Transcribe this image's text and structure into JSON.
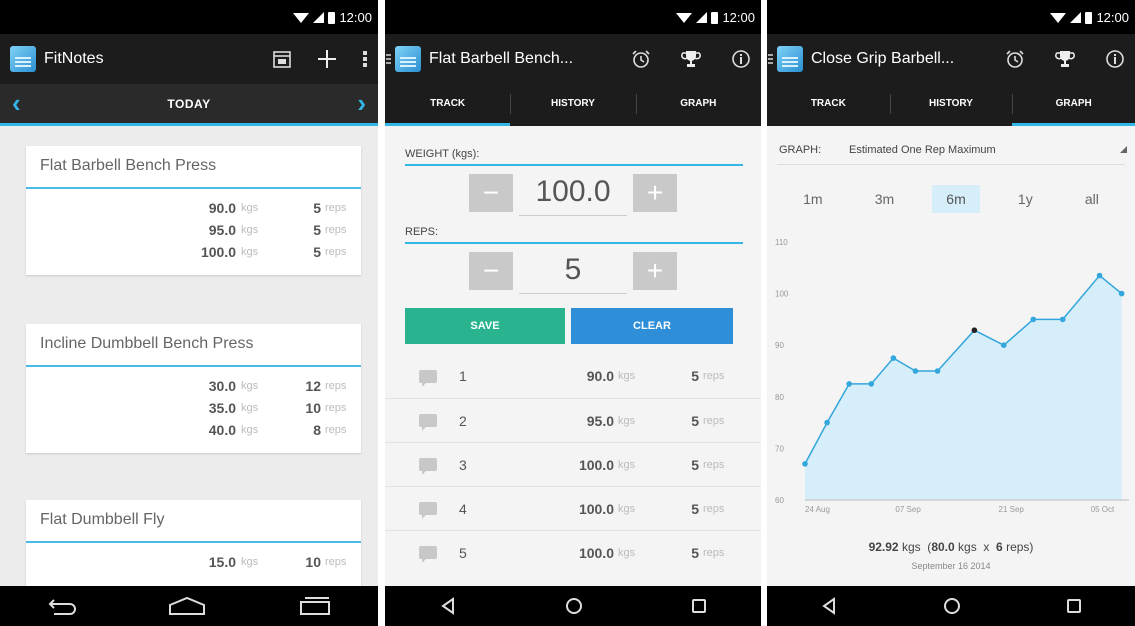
{
  "status": {
    "time": "12:00"
  },
  "screen1": {
    "app_title": "FitNotes",
    "date_label": "TODAY",
    "cards": [
      {
        "title": "Flat Barbell Bench Press",
        "sets": [
          {
            "weight": "90.0",
            "unit": "kgs",
            "reps": "5",
            "reps_unit": "reps"
          },
          {
            "weight": "95.0",
            "unit": "kgs",
            "reps": "5",
            "reps_unit": "reps"
          },
          {
            "weight": "100.0",
            "unit": "kgs",
            "reps": "5",
            "reps_unit": "reps"
          }
        ]
      },
      {
        "title": "Incline Dumbbell Bench Press",
        "sets": [
          {
            "weight": "30.0",
            "unit": "kgs",
            "reps": "12",
            "reps_unit": "reps"
          },
          {
            "weight": "35.0",
            "unit": "kgs",
            "reps": "10",
            "reps_unit": "reps"
          },
          {
            "weight": "40.0",
            "unit": "kgs",
            "reps": "8",
            "reps_unit": "reps"
          }
        ]
      },
      {
        "title": "Flat Dumbbell Fly",
        "sets": [
          {
            "weight": "15.0",
            "unit": "kgs",
            "reps": "10",
            "reps_unit": "reps"
          }
        ]
      }
    ]
  },
  "screen2": {
    "title": "Flat Barbell Bench...",
    "tabs": [
      "TRACK",
      "HISTORY",
      "GRAPH"
    ],
    "weight_label": "WEIGHT (kgs):",
    "weight_value": "100.0",
    "reps_label": "REPS:",
    "reps_value": "5",
    "minus": "−",
    "plus": "+",
    "save_label": "SAVE",
    "clear_label": "CLEAR",
    "sets": [
      {
        "n": "1",
        "weight": "90.0",
        "unit": "kgs",
        "reps": "5",
        "reps_unit": "reps"
      },
      {
        "n": "2",
        "weight": "95.0",
        "unit": "kgs",
        "reps": "5",
        "reps_unit": "reps"
      },
      {
        "n": "3",
        "weight": "100.0",
        "unit": "kgs",
        "reps": "5",
        "reps_unit": "reps"
      },
      {
        "n": "4",
        "weight": "100.0",
        "unit": "kgs",
        "reps": "5",
        "reps_unit": "reps"
      },
      {
        "n": "5",
        "weight": "100.0",
        "unit": "kgs",
        "reps": "5",
        "reps_unit": "reps"
      }
    ]
  },
  "screen3": {
    "title": "Close Grip Barbell...",
    "tabs": [
      "TRACK",
      "HISTORY",
      "GRAPH"
    ],
    "graph_label": "GRAPH:",
    "graph_value": "Estimated One Rep Maximum",
    "ranges": [
      "1m",
      "3m",
      "6m",
      "1y",
      "all"
    ],
    "active_range": "6m",
    "readout": {
      "value": "92.92",
      "unit": "kgs",
      "weight": "80.0",
      "weight_unit": "kgs",
      "times": "x",
      "reps": "6",
      "reps_unit": "reps",
      "date": "September 16 2014"
    }
  },
  "colors": {
    "accent": "#33b5e5",
    "save": "#2ab38f",
    "clear": "#2e8fd8",
    "area": "#d6eef9",
    "line": "#33a6dc"
  },
  "chart_data": {
    "type": "area",
    "ylim": [
      60,
      110
    ],
    "yticks": [
      "110",
      "100",
      "90",
      "80",
      "70",
      "60"
    ],
    "xticks": [
      "24 Aug",
      "07 Sep",
      "21 Sep",
      "05 Oct"
    ],
    "x_day_offsets": [
      0,
      14,
      28,
      42
    ],
    "x": [
      0,
      3,
      6,
      9,
      12,
      15,
      18,
      23,
      27,
      31,
      35,
      40,
      43
    ],
    "values": [
      67,
      75,
      82.5,
      82.5,
      87.5,
      85,
      85,
      92.9,
      90,
      95,
      95,
      103.5,
      100
    ],
    "highlight_index": 7
  }
}
